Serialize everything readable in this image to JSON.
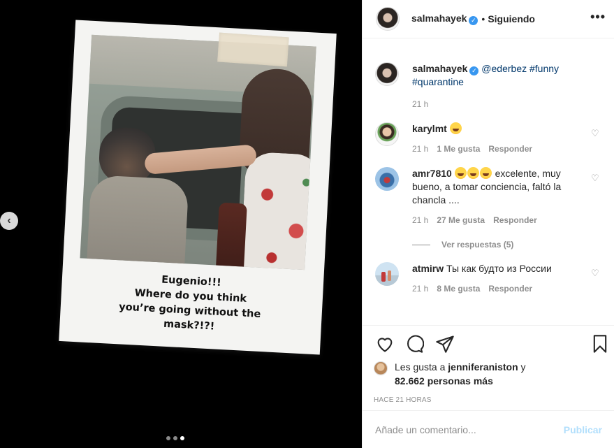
{
  "post": {
    "caption_lines": [
      "Eugenio!!!",
      "Where do you think",
      "you’re going without the",
      "mask?!?!"
    ],
    "carousel": {
      "slide_count": 3,
      "active_index": 2
    }
  },
  "header": {
    "username": "salmahayek",
    "separator": "•",
    "follow_status": "Siguiendo",
    "more": "•••"
  },
  "caption": {
    "username": "salmahayek",
    "mention": "@ederbez",
    "hashtag1": "#funny",
    "hashtag2": "#quarantine",
    "time": "21 h"
  },
  "comments": [
    {
      "username": "karylmt",
      "text": "",
      "time": "21 h",
      "likes": "1 Me gusta",
      "reply": "Responder"
    },
    {
      "username": "amr7810",
      "text": "excelente, muy bueno, a tomar conciencia, faltó la chancla ....",
      "time": "21 h",
      "likes": "27 Me gusta",
      "reply": "Responder"
    },
    {
      "username": "atmirw",
      "text": "Ты как будто из России",
      "time": "21 h",
      "likes": "8 Me gusta",
      "reply": "Responder"
    }
  ],
  "view_replies": "Ver respuestas (5)",
  "likes": {
    "prefix": "Les gusta a",
    "user": "jenniferaniston",
    "suffix": "y",
    "count": "82.662 personas más"
  },
  "time_ago": "HACE 21 HORAS",
  "add_comment": {
    "placeholder": "Añade un comentario...",
    "post_label": "Publicar"
  },
  "colors": {
    "accent": "#3897f0",
    "link": "#00376b",
    "muted": "#8e8e8e",
    "post_disabled": "#b2dffc"
  }
}
